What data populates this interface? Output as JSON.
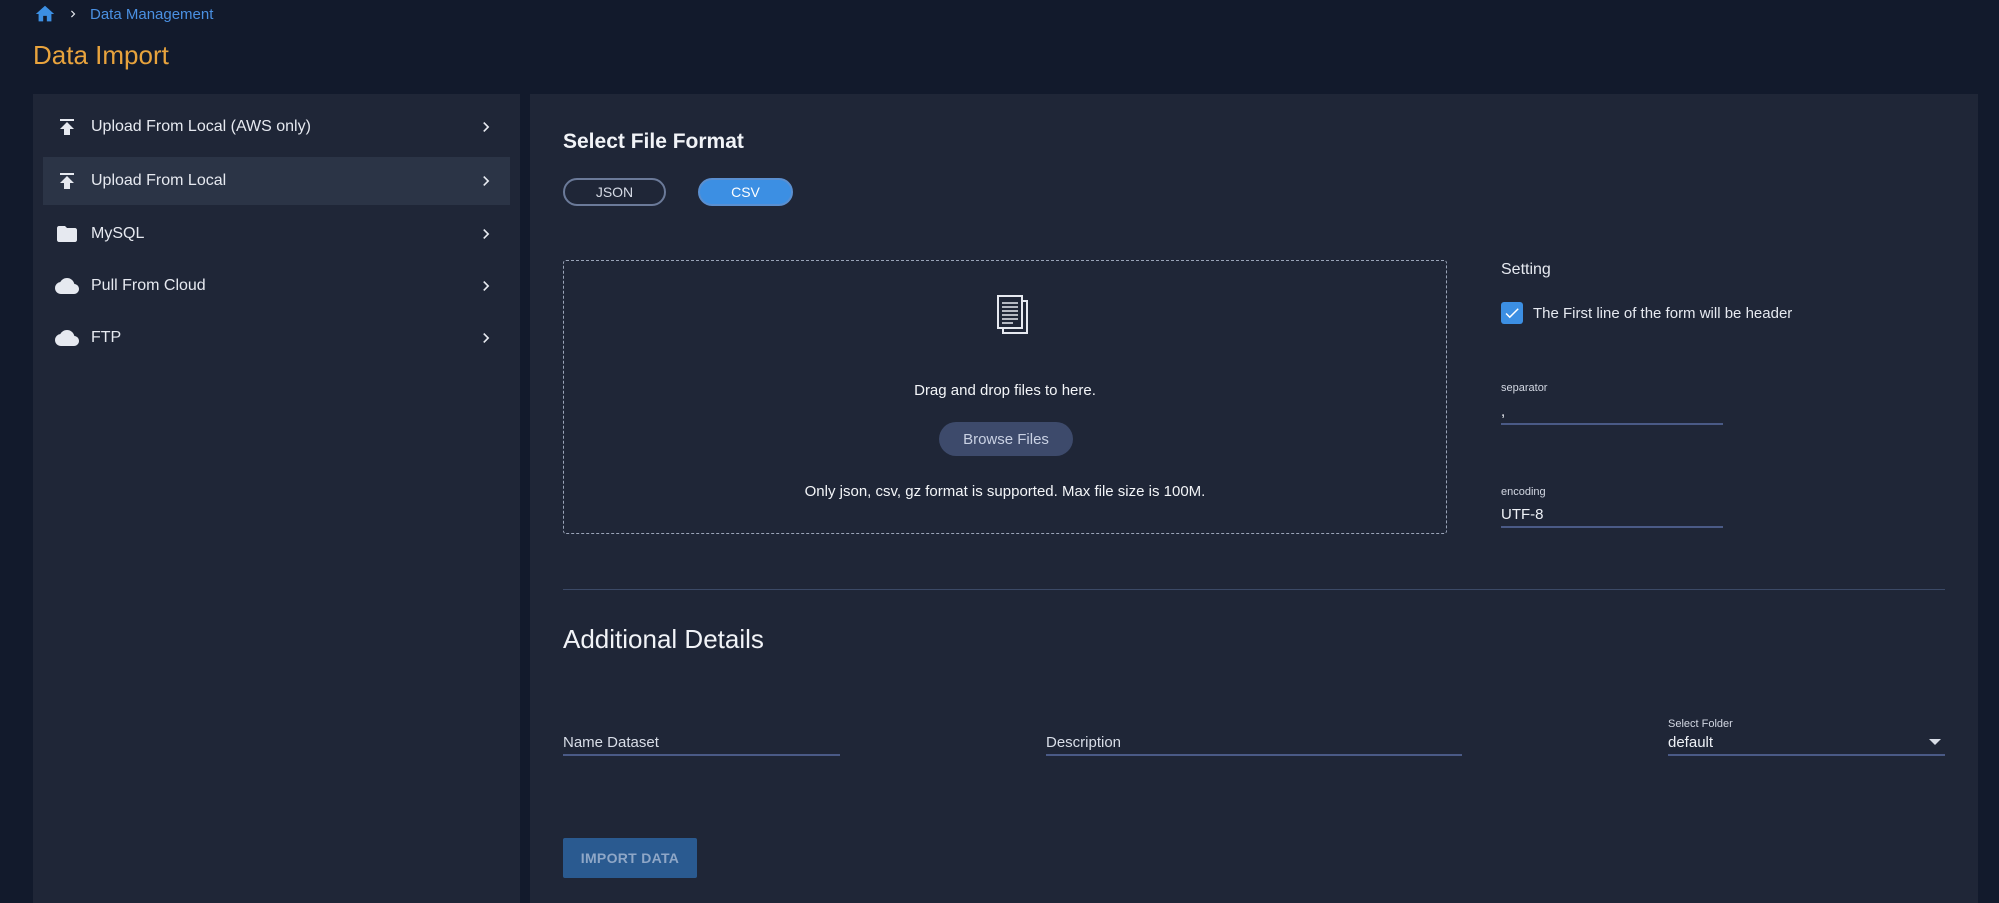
{
  "breadcrumb": {
    "home_icon": "home-icon",
    "separator_icon": "chevron-right-icon",
    "section": "Data Management"
  },
  "page": {
    "title": "Data Import"
  },
  "sidebar": {
    "items": [
      {
        "label": "Upload From Local (AWS only)",
        "icon": "upload-icon"
      },
      {
        "label": "Upload From Local",
        "icon": "upload-icon",
        "active": true
      },
      {
        "label": "MySQL",
        "icon": "folder-icon"
      },
      {
        "label": "Pull From Cloud",
        "icon": "cloud-icon"
      },
      {
        "label": "FTP",
        "icon": "cloud-icon"
      }
    ]
  },
  "format": {
    "title": "Select File Format",
    "options": [
      {
        "label": "JSON",
        "selected": false
      },
      {
        "label": "CSV",
        "selected": true
      }
    ]
  },
  "dropzone": {
    "icon": "document-stack-icon",
    "drag_text": "Drag and drop files to here.",
    "browse_label": "Browse Files",
    "note": "Only json, csv, gz format is supported. Max file size is 100M."
  },
  "setting": {
    "title": "Setting",
    "header_checkbox": {
      "label": "The First line of the form will be header",
      "checked": true
    },
    "separator": {
      "label": "separator",
      "value": ","
    },
    "encoding": {
      "label": "encoding",
      "value": "UTF-8"
    }
  },
  "details": {
    "title": "Additional Details",
    "name_placeholder": "Name Dataset",
    "description_placeholder": "Description",
    "folder": {
      "label": "Select Folder",
      "value": "default"
    }
  },
  "actions": {
    "import_label": "IMPORT DATA"
  },
  "colors": {
    "background": "#121a2c",
    "panel": "#1f2637",
    "accent": "#3c8fe3",
    "title": "#e8a33d",
    "link": "#4a90e2"
  }
}
